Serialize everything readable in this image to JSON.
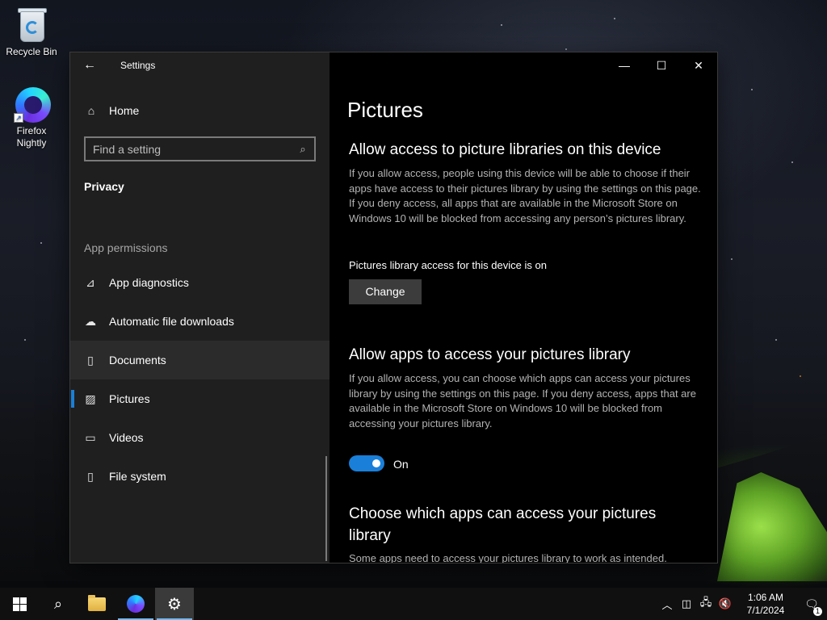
{
  "desktop": {
    "icons": [
      {
        "label": "Recycle Bin",
        "icon": "recycle-bin-icon"
      },
      {
        "label": "Firefox Nightly",
        "icon": "firefox-nightly-icon"
      }
    ]
  },
  "window": {
    "title": "Settings",
    "caption": {
      "minimize": "—",
      "maximize": "☐",
      "close": "✕"
    }
  },
  "sidebar": {
    "home_label": "Home",
    "search_placeholder": "Find a setting",
    "section": "Privacy",
    "group": "App permissions",
    "items": [
      {
        "label": "App diagnostics",
        "icon": "chart-icon",
        "glyph": "📈"
      },
      {
        "label": "Automatic file downloads",
        "icon": "cloud-icon",
        "glyph": "☁"
      },
      {
        "label": "Documents",
        "icon": "document-icon",
        "glyph": "🗋"
      },
      {
        "label": "Pictures",
        "icon": "picture-icon",
        "glyph": "🖼"
      },
      {
        "label": "Videos",
        "icon": "video-icon",
        "glyph": "▭"
      },
      {
        "label": "File system",
        "icon": "file-icon",
        "glyph": "🗋"
      }
    ],
    "selected_index": 3,
    "hover_index": 2
  },
  "content": {
    "page_title": "Pictures",
    "section1": {
      "heading": "Allow access to picture libraries on this device",
      "description": "If you allow access, people using this device will be able to choose if their apps have access to their pictures library by using the settings on this page. If you deny access, all apps that are available in the Microsoft Store on Windows 10 will be blocked from accessing any person’s pictures library.",
      "status": "Pictures library access for this device is on",
      "button": "Change"
    },
    "section2": {
      "heading": "Allow apps to access your pictures library",
      "description": "If you allow access, you can choose which apps can access your pictures library by using the settings on this page. If you deny access, apps that are available in the Microsoft Store on Windows 10 will be blocked from accessing your pictures library.",
      "toggle_state": "On",
      "toggle_on": true
    },
    "section3": {
      "heading": "Choose which apps can access your pictures library",
      "description": "Some apps need to access your pictures library to work as intended."
    }
  },
  "taskbar": {
    "apps": [
      {
        "name": "start",
        "icon": "windows-logo-icon"
      },
      {
        "name": "search",
        "icon": "search-icon"
      },
      {
        "name": "file-explorer",
        "icon": "folder-icon"
      },
      {
        "name": "firefox-nightly",
        "icon": "firefox-nightly-icon"
      },
      {
        "name": "settings",
        "icon": "gear-icon",
        "active": true
      }
    ],
    "time": "1:06 AM",
    "date": "7/1/2024",
    "notification_count": "1"
  },
  "colors": {
    "accent": "#1a7fd8",
    "sidebar_bg": "#1f1f1f",
    "content_bg": "#000000"
  }
}
